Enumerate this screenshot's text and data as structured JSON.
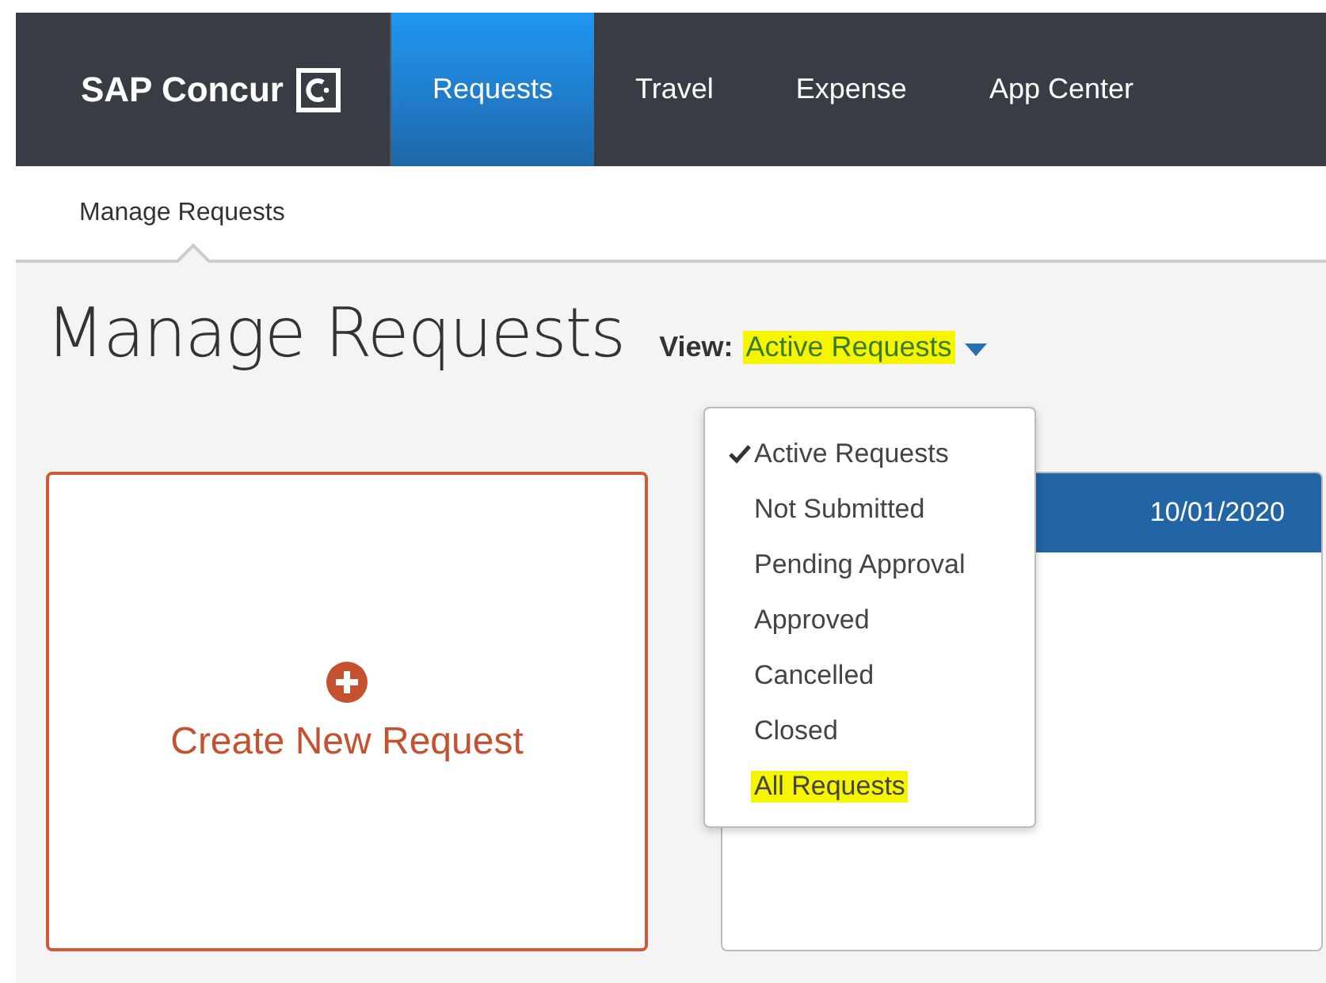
{
  "brand": {
    "name": "SAP Concur"
  },
  "nav": [
    {
      "label": "Requests",
      "selected": true
    },
    {
      "label": "Travel",
      "selected": false
    },
    {
      "label": "Expense",
      "selected": false
    },
    {
      "label": "App Center",
      "selected": false
    }
  ],
  "subnav": [
    {
      "label": "Manage Requests",
      "selected": true
    }
  ],
  "page_title": "Manage Requests",
  "view": {
    "label": "View:",
    "value": "Active Requests",
    "highlighted": true
  },
  "view_menu": [
    {
      "label": "Active Requests",
      "selected": true,
      "highlighted": false
    },
    {
      "label": "Not Submitted",
      "selected": false,
      "highlighted": false
    },
    {
      "label": "Pending Approval",
      "selected": false,
      "highlighted": false
    },
    {
      "label": "Approved",
      "selected": false,
      "highlighted": false
    },
    {
      "label": "Cancelled",
      "selected": false,
      "highlighted": false
    },
    {
      "label": "Closed",
      "selected": false,
      "highlighted": false
    },
    {
      "label": "All Requests",
      "selected": false,
      "highlighted": true
    }
  ],
  "create_card": {
    "label": "Create New Request"
  },
  "request_card": {
    "date": "10/01/2020"
  }
}
